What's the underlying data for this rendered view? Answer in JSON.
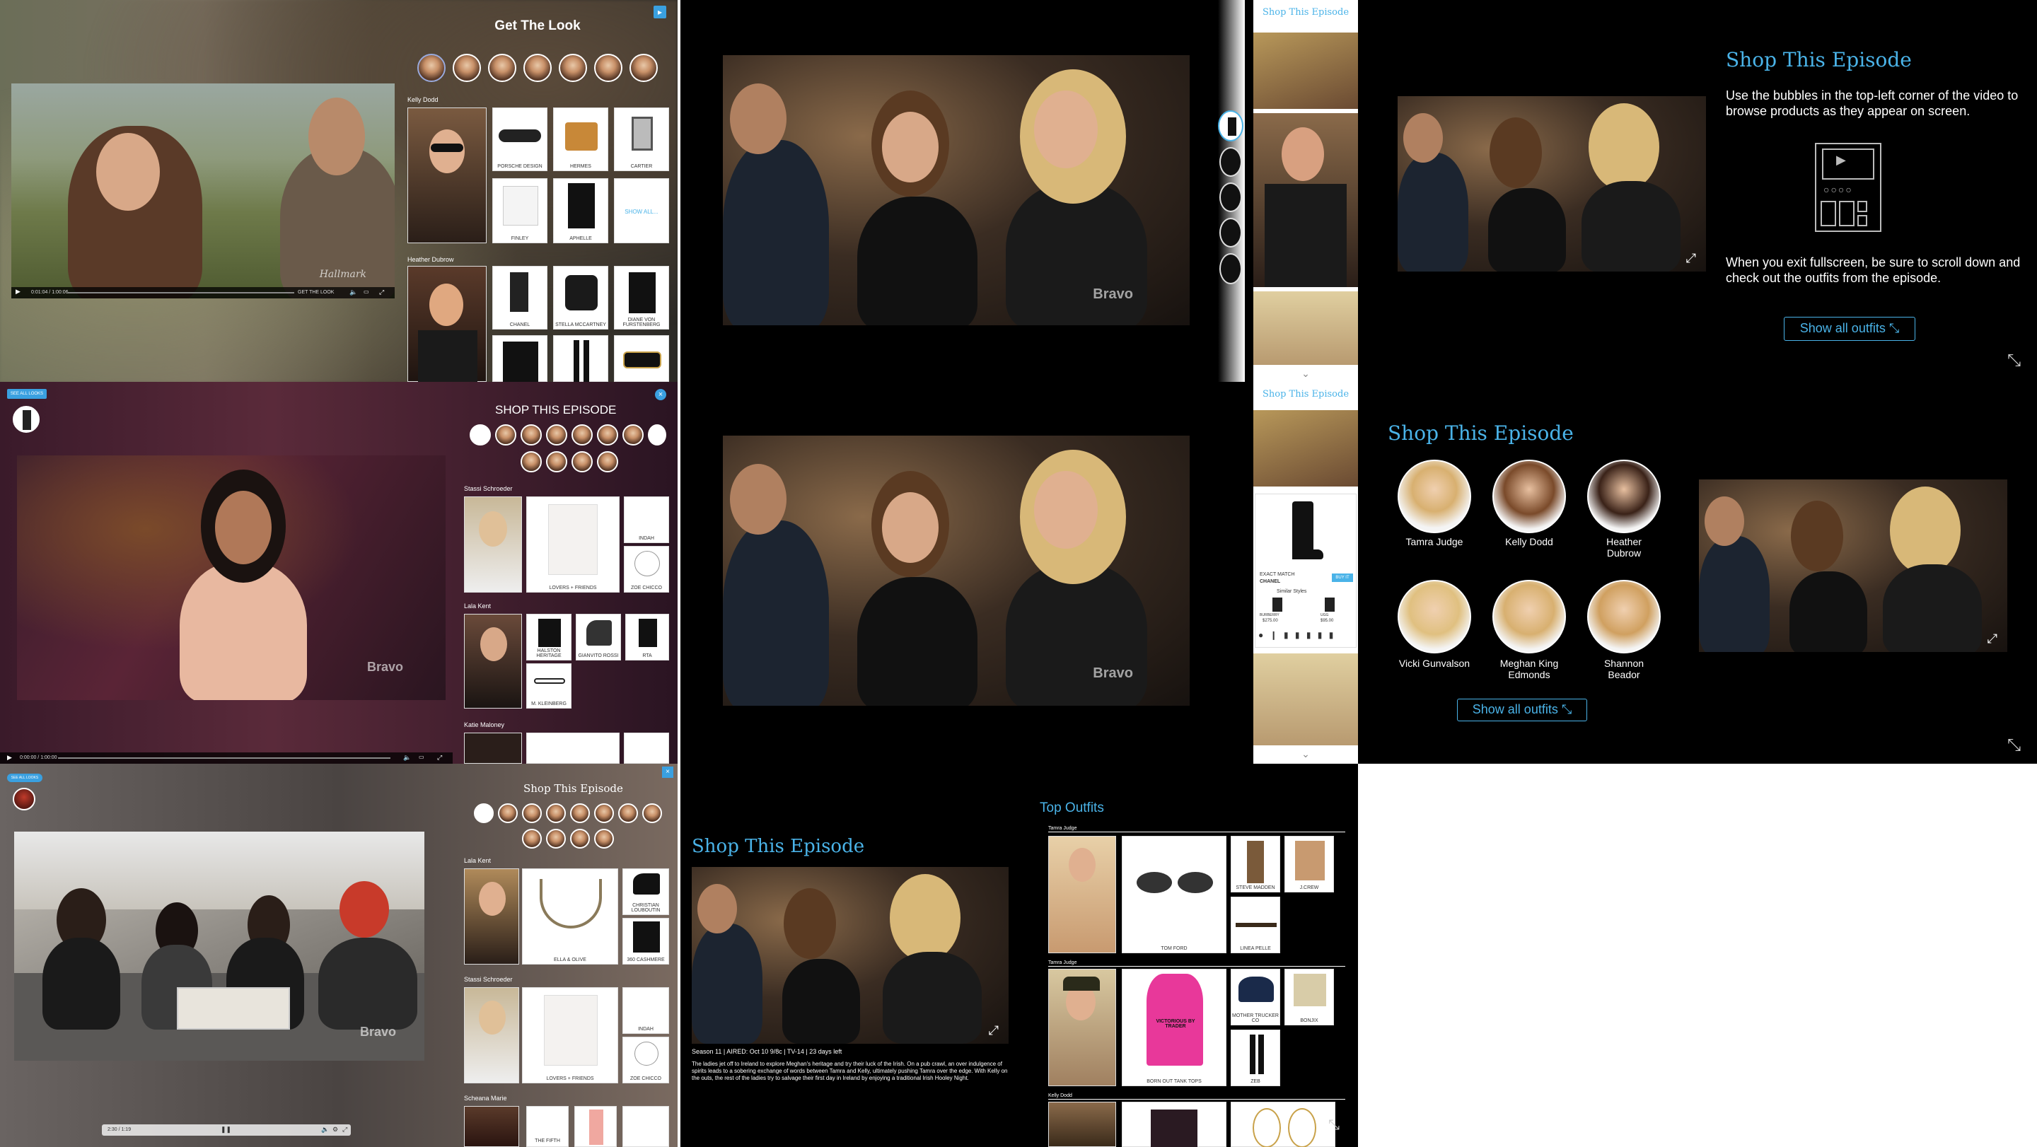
{
  "panel1": {
    "title": "Get The Look",
    "video_time": "0:01:04 / 1:00:06",
    "get_the_look_label": "GET THE LOOK",
    "section1_name": "Kelly Dodd",
    "section1_items": [
      "PORSCHE DESIGN",
      "HERMES",
      "CARTIER",
      "FINLEY",
      "APHELLE"
    ],
    "show_all": "SHOW ALL...",
    "section2_name": "Heather Dubrow",
    "section2_items": [
      "CHANEL",
      "STELLA MCCARTNEY",
      "DIANE VON FURSTENBERG"
    ],
    "watermark": "Hallmark"
  },
  "panel2": {
    "shop_tab": "Shop This Episode",
    "watermark": "Bravo"
  },
  "panel3": {
    "title": "Shop This Episode",
    "instructions": "Use the bubbles in the top-left corner of the video to browse products as they appear on screen.",
    "exit_note": "When you exit fullscreen, be sure to scroll down and check out the outfits from the episode.",
    "button": "Show all outfits"
  },
  "panel4": {
    "badge": "SEE ALL LOOKS",
    "title": "SHOP THIS EPISODE",
    "video_time": "0:00:00 / 1:00:00",
    "section1_name": "Stassi Schroeder",
    "section1_items": [
      "INDAH",
      "LOVERS + FRIENDS",
      "ZOE CHICCO"
    ],
    "section2_name": "Lala Kent",
    "section2_items": [
      "HALSTON HERITAGE",
      "GIANVITO ROSSI",
      "RTA",
      "M. KLEINBERG"
    ],
    "section3_name": "Katie Maloney",
    "watermark": "Bravo"
  },
  "panel5": {
    "shop_tab": "Shop This Episode",
    "product": {
      "match": "EXACT MATCH",
      "brand": "CHANEL",
      "similar": "Similar Styles",
      "buy": "BUY IT",
      "price1": "$275.00",
      "price2": "$95.00",
      "brand2": "BURBERRY",
      "brand3": "UGG"
    },
    "watermark": "Bravo"
  },
  "panel6": {
    "title": "Shop This Episode",
    "cast": [
      "Tamra Judge",
      "Kelly Dodd",
      "Heather Dubrow",
      "Vicki Gunvalson",
      "Meghan King Edmonds",
      "Shannon Beador"
    ],
    "button": "Show all outfits"
  },
  "panel7": {
    "badge": "SEE ALL LOOKS",
    "title": "Shop This Episode",
    "section1_name": "Lala Kent",
    "section1_items": [
      "ELLA & OLIVE",
      "CHRISTIAN LOUBOUTIN",
      "360 CASHMERE"
    ],
    "section2_name": "Stassi Schroeder",
    "section2_items": [
      "INDAH",
      "LOVERS + FRIENDS",
      "ZOE CHICCO"
    ],
    "section3_name": "Scheana Marie",
    "section3_items": [
      "THE FIFTH"
    ],
    "video_time": "2:30 / 1:19",
    "watermark": "Bravo"
  },
  "panel8": {
    "title": "Shop This Episode",
    "meta": "Season 11 | AIRED: Oct 10 9/8c | TV-14 | 23 days left",
    "description": "The ladies jet off to Ireland to explore Meghan's heritage and try their luck of the Irish. On a pub crawl, an over indulgence of spirits leads to a sobering exchange of words between Tamra and Kelly, ultimately pushing Tamra over the edge. With Kelly on the outs, the rest of the ladies try to salvage their first day in Ireland by enjoying a traditional Irish Hooley Night.",
    "top_outfits": "Top Outfits",
    "row1_name": "Tamra Judge",
    "row1_items": [
      "TOM FORD",
      "STEVE MADDEN",
      "LINEA PELLE",
      "J.CREW"
    ],
    "row2_name": "Tamra Judge",
    "row2_items": [
      "BORN OUT TANK TOPS",
      "MOTHER TRUCKER CO",
      "BONJIX",
      "ZEB"
    ],
    "row2_text": "VICTORIOUS BY TRADER",
    "row3_name": "Kelly Dodd"
  }
}
